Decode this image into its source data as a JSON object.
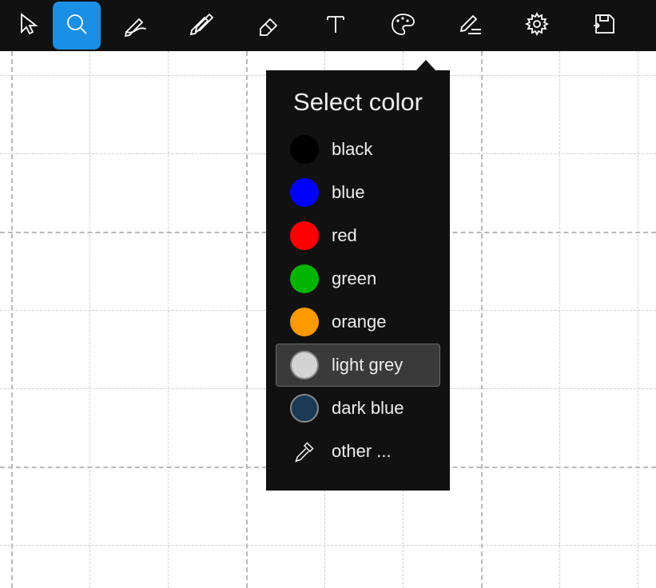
{
  "toolbar": {
    "tools": [
      {
        "name": "pointer",
        "selected": false
      },
      {
        "name": "zoom",
        "selected": true
      },
      {
        "name": "pen",
        "selected": false
      },
      {
        "name": "marker",
        "selected": false
      },
      {
        "name": "eraser",
        "selected": false
      },
      {
        "name": "text",
        "selected": false
      },
      {
        "name": "color",
        "selected": false
      },
      {
        "name": "annotate",
        "selected": false
      },
      {
        "name": "settings",
        "selected": false
      },
      {
        "name": "save",
        "selected": false
      }
    ]
  },
  "color_popup": {
    "title": "Select color",
    "options": [
      {
        "label": "black",
        "hex": "#000000",
        "stroked": false,
        "selected": false
      },
      {
        "label": "blue",
        "hex": "#0000ff",
        "stroked": false,
        "selected": false
      },
      {
        "label": "red",
        "hex": "#ff0000",
        "stroked": false,
        "selected": false
      },
      {
        "label": "green",
        "hex": "#00b400",
        "stroked": false,
        "selected": false
      },
      {
        "label": "orange",
        "hex": "#ff9900",
        "stroked": false,
        "selected": false
      },
      {
        "label": "light grey",
        "hex": "#d3d3d3",
        "stroked": true,
        "selected": true
      },
      {
        "label": "dark blue",
        "hex": "#1a3a55",
        "stroked": true,
        "selected": false
      }
    ],
    "other_label": "other ..."
  }
}
